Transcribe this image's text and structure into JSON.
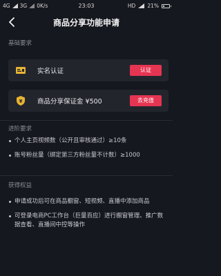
{
  "status_bar": {
    "left_text": "4G",
    "signal2": "3G",
    "speed": "0K/s",
    "time": "23:03",
    "hd": "HD",
    "battery": "21%",
    "battery_level": 0.21
  },
  "nav": {
    "title": "商品分享功能申请"
  },
  "basic": {
    "title": "基础要求",
    "items": [
      {
        "label": "实名认证",
        "button": "认证"
      },
      {
        "label": "商品分享保证金 ¥500",
        "button": "去充值"
      }
    ]
  },
  "advanced": {
    "title": "进阶要求",
    "items": [
      "个人主页视频数（公开且审核通过）≥10条",
      "账号粉丝量（绑定第三方粉丝量不计数）≥1000"
    ]
  },
  "benefits": {
    "title": "获得权益",
    "items": [
      "申请成功后可在商品橱窗、短视频、直播中添加商品",
      "可登录电商PC工作台（巨量百应）进行橱窗管理、推广数据查看、直播间中控等操作"
    ]
  },
  "colors": {
    "accent": "#e63552",
    "icon_yellow": "#e8b533",
    "background": "#16181f",
    "card": "#23252d"
  }
}
